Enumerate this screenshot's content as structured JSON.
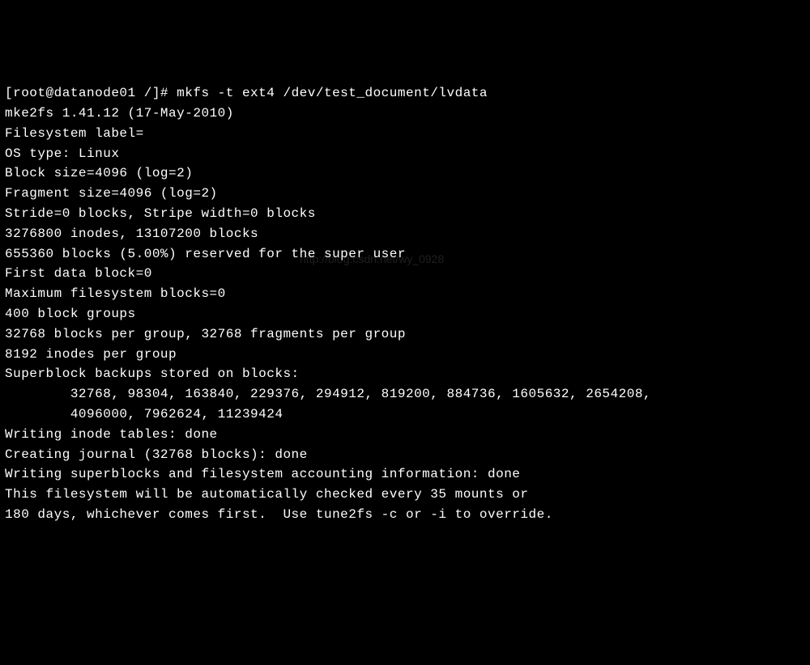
{
  "terminal": {
    "prompt": "[root@datanode01 /]# ",
    "command": "mkfs -t ext4 /dev/test_document/lvdata",
    "lines": [
      "mke2fs 1.41.12 (17-May-2010)",
      "Filesystem label=",
      "OS type: Linux",
      "Block size=4096 (log=2)",
      "Fragment size=4096 (log=2)",
      "Stride=0 blocks, Stripe width=0 blocks",
      "3276800 inodes, 13107200 blocks",
      "655360 blocks (5.00%) reserved for the super user",
      "First data block=0",
      "Maximum filesystem blocks=0",
      "400 block groups",
      "32768 blocks per group, 32768 fragments per group",
      "8192 inodes per group",
      "Superblock backups stored on blocks:",
      "        32768, 98304, 163840, 229376, 294912, 819200, 884736, 1605632, 2654208,",
      "        4096000, 7962624, 11239424",
      "",
      "Writing inode tables: done",
      "Creating journal (32768 blocks): done",
      "Writing superblocks and filesystem accounting information: done",
      "",
      "This filesystem will be automatically checked every 35 mounts or",
      "180 days, whichever comes first.  Use tune2fs -c or -i to override."
    ]
  },
  "watermark": "http://blog.csdn.net/wy_0928"
}
